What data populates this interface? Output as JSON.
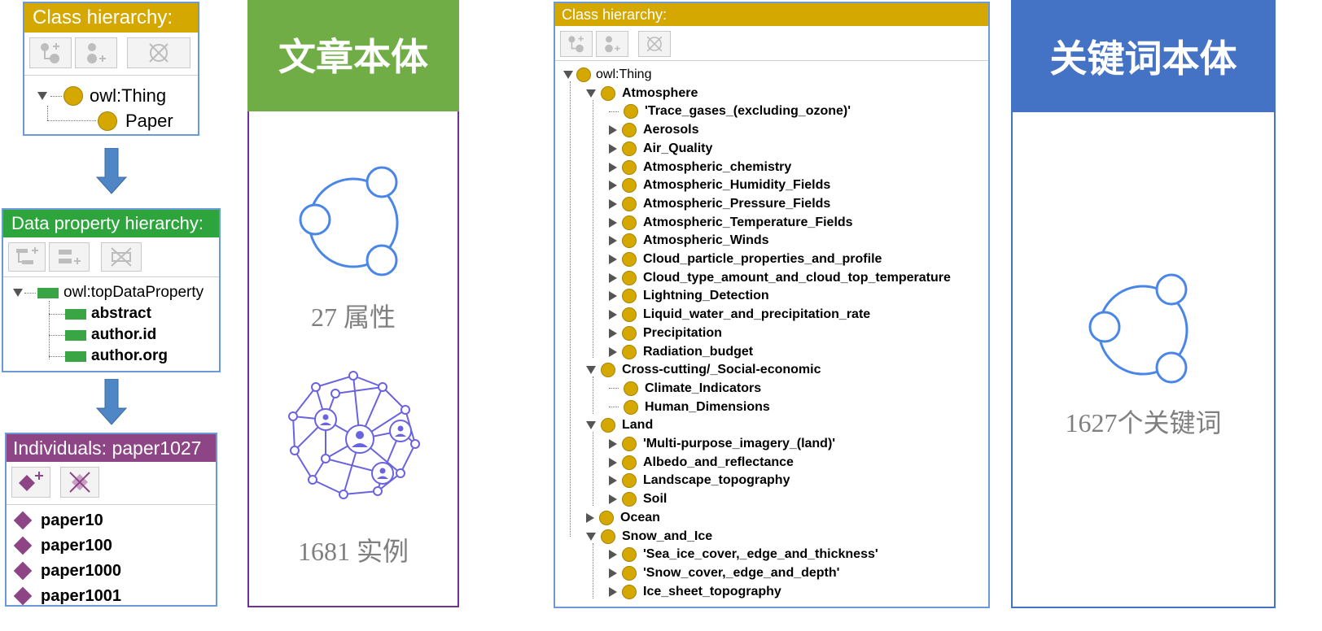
{
  "paper_ontology": {
    "class_panel": {
      "title": "Class hierarchy:",
      "toolbar": [
        "add-subclass-icon",
        "add-sibling-class-icon",
        "delete-class-icon"
      ],
      "root": "owl:Thing",
      "child": "Paper"
    },
    "data_property_panel": {
      "title": "Data property hierarchy:",
      "toolbar": [
        "add-sub-property-icon",
        "add-sibling-property-icon",
        "delete-property-icon"
      ],
      "root": "owl:topDataProperty",
      "items": [
        "abstract",
        "author.id",
        "author.org"
      ]
    },
    "individuals_panel": {
      "title": "Individuals: paper1027",
      "toolbar": [
        "add-individual-icon",
        "delete-individual-icon"
      ],
      "items": [
        "paper10",
        "paper100",
        "paper1000",
        "paper1001"
      ]
    },
    "card": {
      "title": "文章本体",
      "properties_caption": "27 属性",
      "instances_caption": "1681 实例",
      "header_color": "#70ad47",
      "border_color": "#7030a0"
    }
  },
  "keyword_ontology": {
    "class_panel": {
      "title": "Class hierarchy:",
      "toolbar": [
        "add-subclass-icon",
        "add-sibling-class-icon",
        "delete-class-icon"
      ],
      "root": "owl:Thing",
      "tree": [
        {
          "label": "Atmosphere",
          "level": 1,
          "expander": "open"
        },
        {
          "label": "'Trace_gases_(excluding_ozone)'",
          "level": 2,
          "expander": "none"
        },
        {
          "label": "Aerosols",
          "level": 2,
          "expander": "closed"
        },
        {
          "label": "Air_Quality",
          "level": 2,
          "expander": "closed"
        },
        {
          "label": "Atmospheric_chemistry",
          "level": 2,
          "expander": "closed"
        },
        {
          "label": "Atmospheric_Humidity_Fields",
          "level": 2,
          "expander": "closed"
        },
        {
          "label": "Atmospheric_Pressure_Fields",
          "level": 2,
          "expander": "closed"
        },
        {
          "label": "Atmospheric_Temperature_Fields",
          "level": 2,
          "expander": "closed"
        },
        {
          "label": "Atmospheric_Winds",
          "level": 2,
          "expander": "closed"
        },
        {
          "label": "Cloud_particle_properties_and_profile",
          "level": 2,
          "expander": "closed"
        },
        {
          "label": "Cloud_type_amount_and_cloud_top_temperature",
          "level": 2,
          "expander": "closed"
        },
        {
          "label": "Lightning_Detection",
          "level": 2,
          "expander": "closed"
        },
        {
          "label": "Liquid_water_and_precipitation_rate",
          "level": 2,
          "expander": "closed"
        },
        {
          "label": "Precipitation",
          "level": 2,
          "expander": "closed"
        },
        {
          "label": "Radiation_budget",
          "level": 2,
          "expander": "closed"
        },
        {
          "label": "Cross-cutting/_Social-economic",
          "level": 1,
          "expander": "open"
        },
        {
          "label": "Climate_Indicators",
          "level": 2,
          "expander": "none"
        },
        {
          "label": "Human_Dimensions",
          "level": 2,
          "expander": "none"
        },
        {
          "label": "Land",
          "level": 1,
          "expander": "open"
        },
        {
          "label": "'Multi-purpose_imagery_(land)'",
          "level": 2,
          "expander": "closed"
        },
        {
          "label": "Albedo_and_reflectance",
          "level": 2,
          "expander": "closed"
        },
        {
          "label": "Landscape_topography",
          "level": 2,
          "expander": "closed"
        },
        {
          "label": "Soil",
          "level": 2,
          "expander": "closed"
        },
        {
          "label": "Ocean",
          "level": 1,
          "expander": "closed"
        },
        {
          "label": "Snow_and_Ice",
          "level": 1,
          "expander": "open"
        },
        {
          "label": "'Sea_ice_cover,_edge_and_thickness'",
          "level": 2,
          "expander": "closed"
        },
        {
          "label": "'Snow_cover,_edge_and_depth'",
          "level": 2,
          "expander": "closed"
        },
        {
          "label": "Ice_sheet_topography",
          "level": 2,
          "expander": "closed"
        }
      ]
    },
    "card": {
      "title": "关键词本体",
      "keywords_caption": "1627个关键词",
      "header_color": "#4472c4",
      "border_color": "#4472c4"
    }
  },
  "colors": {
    "class_header": "#d4a800",
    "data_property_header": "#2ea43d",
    "individuals_header": "#8e4585",
    "panel_border": "#6c9ad6",
    "flow_arrow": "#4f86c6",
    "icon_line": "#4a86e8",
    "network_icon": "#6a63e0"
  }
}
